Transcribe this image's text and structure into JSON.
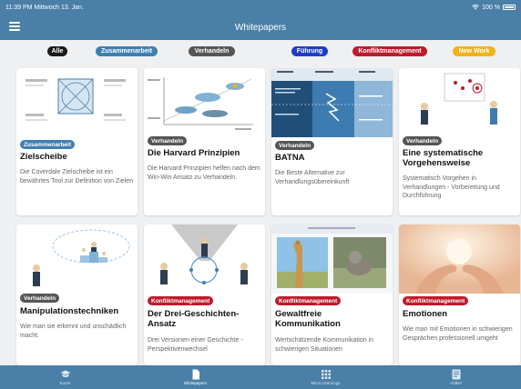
{
  "status": {
    "time_date": "11:39 PM  Mittwoch 13. Jan.",
    "battery": "100 %"
  },
  "header": {
    "title": "Whitepapers"
  },
  "filters": [
    {
      "label": "Alle",
      "color": "#1a1a1a"
    },
    {
      "label": "Zusammenarbeit",
      "color": "#3f7fb3"
    },
    {
      "label": "Verhandeln",
      "color": "#555555"
    },
    {
      "label": "Führung",
      "color": "#1f3ec8"
    },
    {
      "label": "Konfliktmanagement",
      "color": "#c0192a"
    },
    {
      "label": "New Work",
      "color": "#f2b21b"
    }
  ],
  "cards": [
    {
      "badge": "Zusammenarbeit",
      "badge_color": "#3f7fb3",
      "title": "Zielscheibe",
      "desc": "Die Coverdale Zielscheibe ist ein bewährtes Tool zur Definition von Zielen",
      "image": "target-diagram"
    },
    {
      "badge": "Verhandeln",
      "badge_color": "#555555",
      "title": "Die Harvard Prinzipien",
      "desc": "Die Harvard Prinzipien helfen nach dem Win-Win Ansatz zu Verhandeln.",
      "image": "harvard-chart"
    },
    {
      "badge": "Verhandeln",
      "badge_color": "#555555",
      "title": "BATNA",
      "desc": "Die Beste Alternative zur Verhandlungsübereinkunft",
      "image": "batna-table"
    },
    {
      "badge": "Verhandeln",
      "badge_color": "#555555",
      "title": "Eine systematische Vorgehensweise",
      "desc": "Systematisch Vorgehen in Verhandlungen - Vorbereitung und Durchführung",
      "image": "presentation-figures"
    },
    {
      "badge": "Verhandeln",
      "badge_color": "#555555",
      "title": "Manipulationstechniken",
      "desc": "Wie man sie erkennt und unschädlich macht.",
      "image": "podium-figures"
    },
    {
      "badge": "Konfliktmanagement",
      "badge_color": "#c0192a",
      "title": "Der Drei-Geschichten-Ansatz",
      "desc": "Drei Versionen einer Geschichte - Perspektivenwechsel",
      "image": "three-stories"
    },
    {
      "badge": "Konfliktmanagement",
      "badge_color": "#c0192a",
      "title": "Gewaltfreie Kommunikation",
      "desc": "Wertschätzende Kommunikation in schwierigen Situationen",
      "image": "giraffe-wolf"
    },
    {
      "badge": "Konfliktmanagement",
      "badge_color": "#c0192a",
      "title": "Emotionen",
      "desc": "Wie man mit Emotionen in schwierigen Gesprächen professionell umgeht",
      "image": "hands-photo"
    }
  ],
  "tabs": [
    {
      "label": "Kurse",
      "icon": "graduation-cap-icon",
      "active": false
    },
    {
      "label": "Whitepapers",
      "icon": "document-icon",
      "active": true
    },
    {
      "label": "Micro Learnings",
      "icon": "grid-dots-icon",
      "active": false
    },
    {
      "label": "Artikel",
      "icon": "article-icon",
      "active": false
    }
  ]
}
